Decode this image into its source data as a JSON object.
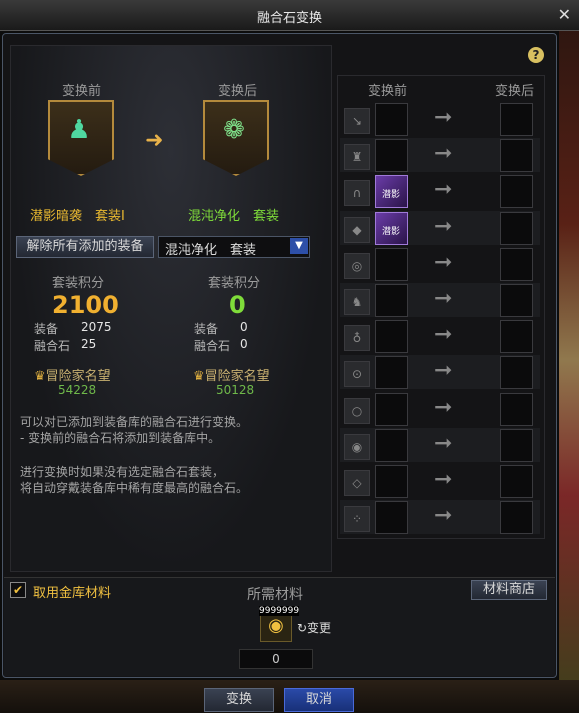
{
  "window": {
    "title": "融合石变换",
    "close": "✕",
    "help": "?"
  },
  "left": {
    "before_header": "变换前",
    "after_header": "变换后",
    "before_set": "潜影暗袭　套装Ⅰ",
    "after_set": "混沌净化　套装",
    "remove_button": "解除所有添加的装备",
    "dropdown_value": "混沌净化　套装",
    "before_points_label": "套装积分",
    "before_points": "2100",
    "after_points_label": "套装积分",
    "after_points": "0",
    "equip_label": "装备",
    "before_equip": "2075",
    "after_equip": "0",
    "stone_label": "融合石",
    "before_stone": "25",
    "after_stone": "0",
    "fame_label": "冒险家名望",
    "before_fame": "54228",
    "after_fame": "50128",
    "note1": "可以对已添加到装备库的融合石进行变换。",
    "note2": "- 变换前的融合石将添加到装备库中。",
    "note3": "进行变换时如果没有选定融合石套装，",
    "note4": "将自动穿戴装备库中稀有度最高的融合石。"
  },
  "right": {
    "before_header": "变换前",
    "after_header": "变换后",
    "slots": [
      {
        "slot": "weapon",
        "glyph": "↘",
        "item": ""
      },
      {
        "slot": "top",
        "glyph": "♜",
        "item": ""
      },
      {
        "slot": "pants",
        "glyph": "∩",
        "item": "潜影"
      },
      {
        "slot": "shoulder",
        "glyph": "◆",
        "item": "潜影"
      },
      {
        "slot": "belt",
        "glyph": "◎",
        "item": ""
      },
      {
        "slot": "shoes",
        "glyph": "♞",
        "item": ""
      },
      {
        "slot": "necklace",
        "glyph": "♁",
        "item": ""
      },
      {
        "slot": "bracelet",
        "glyph": "⊙",
        "item": ""
      },
      {
        "slot": "ring",
        "glyph": "○",
        "item": ""
      },
      {
        "slot": "subequip",
        "glyph": "◉",
        "item": ""
      },
      {
        "slot": "magicstone",
        "glyph": "◇",
        "item": ""
      },
      {
        "slot": "earring",
        "glyph": "⁘",
        "item": ""
      }
    ]
  },
  "bottom": {
    "use_gold_label": "取用金库材料",
    "use_gold_checked": "✔",
    "need_label": "所需材料",
    "shop_button": "材料商店",
    "material_count": "9999999",
    "change_label": "↻变更",
    "quantity": "0",
    "convert_button": "变换",
    "cancel_button": "取消"
  }
}
